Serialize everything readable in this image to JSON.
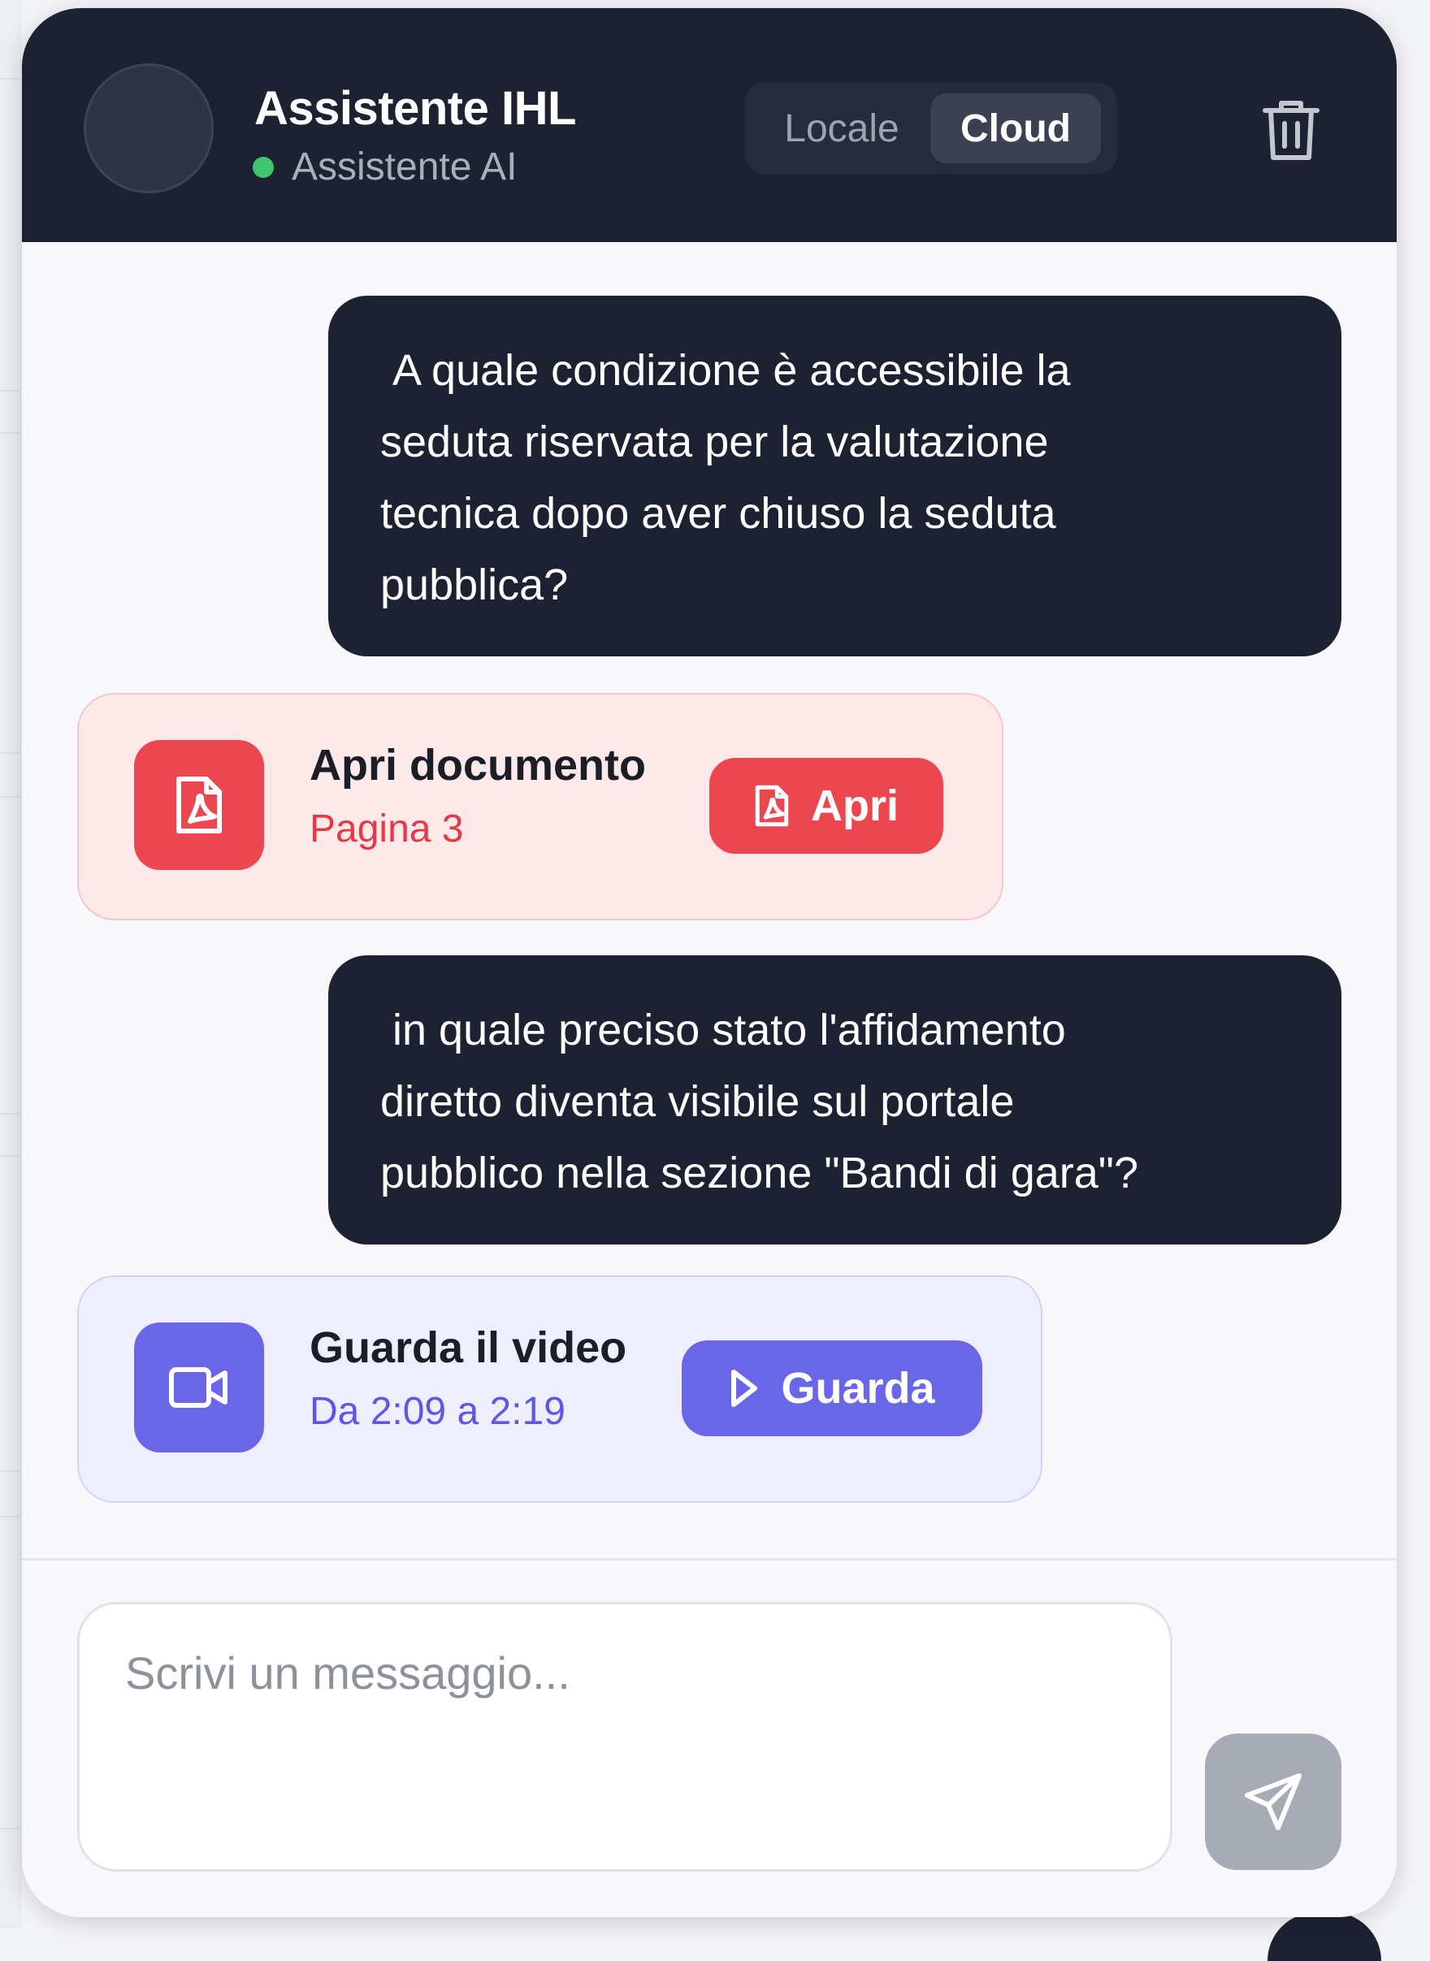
{
  "header": {
    "title": "Assistente IHL",
    "status": "Assistente AI",
    "modes": [
      "Locale",
      "Cloud"
    ],
    "active_mode": "Cloud",
    "delete_icon": "trash-icon"
  },
  "messages": [
    {
      "role": "user",
      "text": " A quale condizione è accessibile la\nseduta riservata per la valutazione\ntecnica dopo aver chiuso la seduta\npubblica?"
    },
    {
      "role": "assistant",
      "type": "document",
      "icon": "pdf-icon",
      "title": "Apri documento",
      "subtitle": "Pagina 3",
      "button_label": "Apri"
    },
    {
      "role": "user",
      "text": " in quale preciso stato l'affidamento\ndiretto diventa visibile sul portale\npubblico nella sezione \"Bandi di gara\"?"
    },
    {
      "role": "assistant",
      "type": "video",
      "icon": "video-camera-icon",
      "title": "Guarda il video",
      "subtitle": "Da 2:09 a 2:19",
      "button_label": "Guarda"
    }
  ],
  "composer": {
    "placeholder": "Scrivi un messaggio...",
    "value": "",
    "send_icon": "send-icon"
  },
  "colors": {
    "header_bg": "#1d2233",
    "online": "#3fc56b",
    "pdf_accent": "#ec4650",
    "video_accent": "#6a66e8",
    "send_disabled": "#a7abb5"
  }
}
